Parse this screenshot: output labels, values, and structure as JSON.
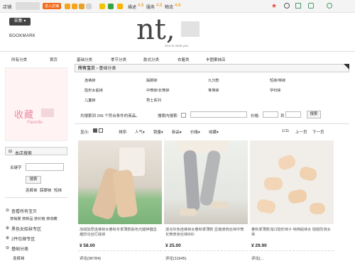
{
  "topbar": {
    "store_label": "店铺:",
    "add_friend": "进入店铺",
    "desc_label": "描述",
    "desc_score": "4.8",
    "service_label": "服务",
    "service_score": "4.8",
    "logistics_label": "物流",
    "logistics_score": "4.8"
  },
  "header": {
    "collect_button": "采集",
    "bookmark": "BOOKMARK",
    "logo_text": "nt,",
    "logo_sub": "nice to meet you"
  },
  "nav": [
    "所有分类",
    "首页",
    "基础分类",
    "季节分类",
    "款式分类",
    "衣着类",
    "丰图案袜店"
  ],
  "breadcrumb": {
    "root": "所有宝贝",
    "current": "基础分类"
  },
  "categories": [
    [
      "连裤袜",
      "踩脚袜",
      "九分款",
      "短袜/棉袜"
    ],
    [
      "隐形女船袜",
      "中筒袜/长筒袜",
      "堆堆袜",
      "孕妇袜"
    ],
    [
      "儿童袜",
      "男士系列",
      "",
      ""
    ]
  ],
  "filter": {
    "result_text": "共搜索到 256 个符合条件的商品。",
    "search_within": "搜索内搜索:",
    "price_label": "价格:",
    "to_label": "到",
    "search_button": "搜索"
  },
  "sortbar": {
    "display_label": "显示:",
    "sort_label": "排序:",
    "popularity": "人气",
    "sales": "销量",
    "newest": "新品",
    "price": "价格",
    "favorites": "收藏",
    "page": "1/11",
    "prev": "上一页",
    "next": "下一页"
  },
  "sidebar": {
    "favorite_text": "收藏",
    "favorite_en": "Favorite",
    "search_title": "本店搜索",
    "keyword_label": "关键字",
    "search_button": "搜索",
    "hot_tags": [
      "连裤袜",
      "踩脚袜",
      "短袜"
    ],
    "view_all": "查看所有宝贝",
    "sort_links": "按销量 按新品 按价格 按收藏",
    "groups": [
      "黑色女船袜专区",
      "2件包邮专区",
      "基础分类"
    ],
    "sub_item": "连裤袜"
  },
  "products": [
    {
      "title": "加绒加厚连裤袜女春秋冬季薄款肤色光腿神器显瘦防勾丝打底袜",
      "price": "¥ 58.00",
      "reviews": "评论(96784)"
    },
    {
      "title": "波点灰色连裤袜女春秋季薄款 显瘦遮肉丝袜中筒长筒修身丝袜80D",
      "price": "¥ 25.00",
      "reviews": "评论(11645)"
    },
    {
      "title": "春秋季薄款浅口隐形袜子 纯棉船袜女 硅胶防滑女袜",
      "price": "¥ 29.90",
      "reviews": "评论(..."
    }
  ],
  "colors": {
    "accent": "#f08c00",
    "header_btn": "#444444",
    "favorite": "#e88aa0"
  }
}
